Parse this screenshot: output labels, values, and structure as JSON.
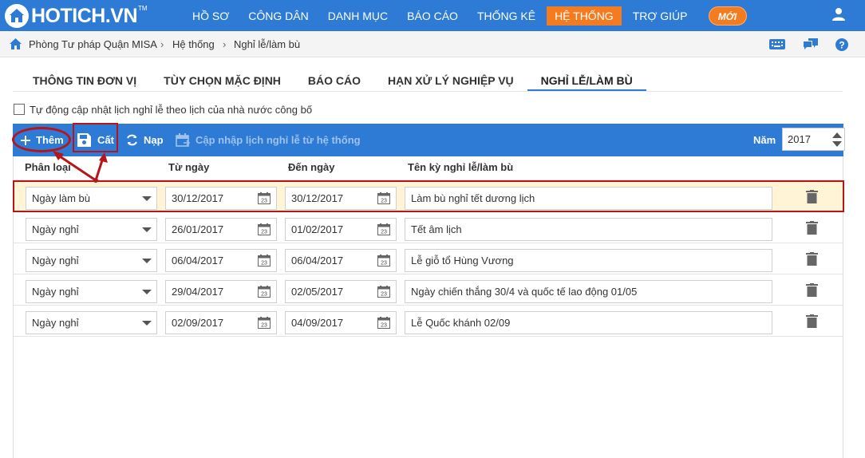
{
  "brand": {
    "logo_text": "HOTICH.VN",
    "trademark": "TM"
  },
  "nav": {
    "items": [
      {
        "label": "HỒ SƠ",
        "active": false
      },
      {
        "label": "CÔNG DÂN",
        "active": false
      },
      {
        "label": "DANH MỤC",
        "active": false
      },
      {
        "label": "BÁO CÁO",
        "active": false
      },
      {
        "label": "THỐNG KÊ",
        "active": false
      },
      {
        "label": "HỆ THỐNG",
        "active": true
      },
      {
        "label": "TRỢ GIÚP",
        "active": false
      }
    ],
    "new_badge": "MỚI"
  },
  "breadcrumb": {
    "items": [
      "Phòng Tư pháp Quận MISA",
      "Hệ thống",
      "Nghỉ lễ/làm bù"
    ]
  },
  "tabs": [
    {
      "label": "THÔNG TIN ĐƠN VỊ",
      "active": false
    },
    {
      "label": "TÙY CHỌN MẶC ĐỊNH",
      "active": false
    },
    {
      "label": "BÁO CÁO",
      "active": false
    },
    {
      "label": "HẠN XỬ LÝ NGHIỆP VỤ",
      "active": false
    },
    {
      "label": "NGHỈ LỄ/LÀM BÙ",
      "active": true
    }
  ],
  "auto_update": {
    "label": "Tự động cập nhật lịch nghỉ lễ theo lịch của nhà nước công bố",
    "checked": false
  },
  "toolbar": {
    "add_label": "Thêm",
    "save_label": "Cất",
    "reload_label": "Nạp",
    "sync_label": "Cập nhập lịch nghỉ lễ từ hệ thống",
    "year_label": "Năm",
    "year_value": "2017"
  },
  "grid": {
    "columns": [
      "Phân loại",
      "Từ ngày",
      "Đến ngày",
      "Tên kỳ nghỉ lễ/làm bù"
    ],
    "rows": [
      {
        "type": "Ngày làm bù",
        "from": "30/12/2017",
        "to": "30/12/2017",
        "name": "Làm bù nghỉ tết dương lịch",
        "selected": true
      },
      {
        "type": "Ngày nghỉ",
        "from": "26/01/2017",
        "to": "01/02/2017",
        "name": "Tết âm lịch",
        "selected": false
      },
      {
        "type": "Ngày nghỉ",
        "from": "06/04/2017",
        "to": "06/04/2017",
        "name": "Lễ giỗ tổ Hùng Vương",
        "selected": false
      },
      {
        "type": "Ngày nghỉ",
        "from": "29/04/2017",
        "to": "02/05/2017",
        "name": "Ngày chiến thắng 30/4 và quốc tế lao động 01/05",
        "selected": false
      },
      {
        "type": "Ngày nghỉ",
        "from": "02/09/2017",
        "to": "04/09/2017",
        "name": "Lễ Quốc khánh 02/09",
        "selected": false
      }
    ]
  },
  "colors": {
    "primary": "#2d7bd4",
    "accent": "#f47b20",
    "highlight": "#b8151b",
    "selected_row": "#fff4d6"
  }
}
